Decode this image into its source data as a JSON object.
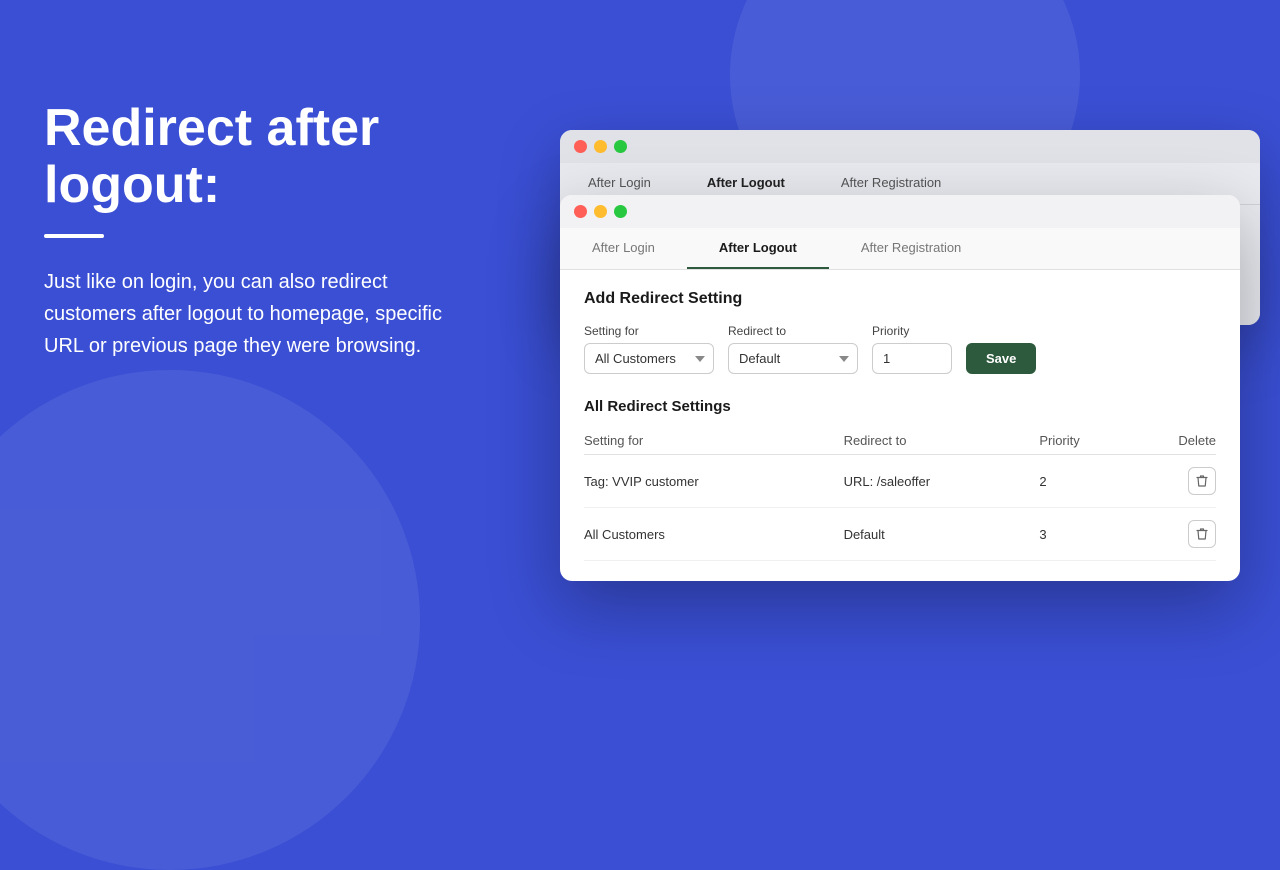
{
  "background": {
    "colors": {
      "main": "#3a4fd4",
      "accent": "#2d5a3d"
    }
  },
  "left_panel": {
    "heading_line1": "Redirect after",
    "heading_line2": "logout:",
    "description": "Just like on login, you can also redirect customers after logout  to homepage, specific URL or previous page they were browsing."
  },
  "window_bg": {
    "tabs": [
      {
        "label": "After Login",
        "active": false
      },
      {
        "label": "After Logout",
        "active": true
      },
      {
        "label": "After Registration",
        "active": false
      }
    ]
  },
  "window_fg": {
    "tabs": [
      {
        "label": "After Login",
        "active": false
      },
      {
        "label": "After Logout",
        "active": true
      },
      {
        "label": "After Registration",
        "active": false
      }
    ],
    "add_section": {
      "title": "Add Redirect Setting",
      "setting_for_label": "Setting for",
      "setting_for_value": "All Customers",
      "redirect_to_label": "Redirect to",
      "redirect_to_value": "Default",
      "priority_label": "Priority",
      "priority_value": "1",
      "save_button": "Save"
    },
    "all_settings": {
      "title": "All Redirect Settings",
      "columns": [
        "Setting for",
        "Redirect to",
        "Priority",
        "Delete"
      ],
      "rows": [
        {
          "setting_for": "Tag: VVIP customer",
          "redirect_to": "URL: /saleoffer",
          "priority": "2"
        },
        {
          "setting_for": "All Customers",
          "redirect_to": "Default",
          "priority": "3"
        }
      ]
    }
  }
}
